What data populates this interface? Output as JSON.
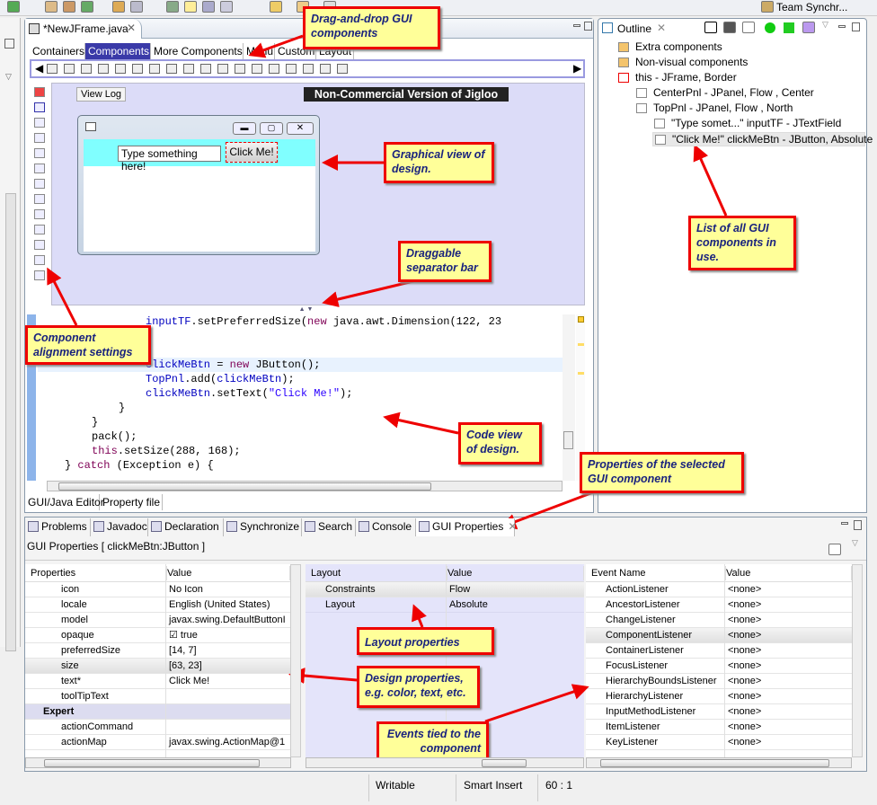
{
  "editor": {
    "tab_title": "*NewJFrame.java",
    "palette_tabs": [
      "Containers",
      "Components",
      "More Components",
      "Menu",
      "Custom",
      "Layout"
    ],
    "active_palette_tab": "Components",
    "view_log": "View Log",
    "banner": "Non-Commercial Version of Jigloo",
    "preview": {
      "textfield": "Type something here!",
      "button": "Click Me!",
      "accent_color": "#80ffff"
    },
    "code_lines": [
      {
        "indent": 6,
        "parts": [
          [
            "fd",
            "inputTF"
          ],
          [
            "",
            "."
          ],
          [
            "",
            "setPreferredSize("
          ],
          [
            "kw",
            "new"
          ],
          [
            "",
            " java.awt.Dimension(122, 23"
          ]
        ]
      },
      {
        "indent": 5,
        "parts": [
          [
            "",
            "}"
          ]
        ]
      },
      {
        "indent": 5,
        "parts": [
          [
            "",
            "{"
          ]
        ]
      },
      {
        "indent": 6,
        "highlight": true,
        "parts": [
          [
            "fd",
            "clickMeBtn"
          ],
          [
            "",
            " = "
          ],
          [
            "kw",
            "new"
          ],
          [
            "",
            " JButton();"
          ]
        ]
      },
      {
        "indent": 6,
        "parts": [
          [
            "fd",
            "TopPnl"
          ],
          [
            "",
            ".add("
          ],
          [
            "fd",
            "clickMeBtn"
          ],
          [
            "",
            ");"
          ]
        ]
      },
      {
        "indent": 6,
        "parts": [
          [
            "fd",
            "clickMeBtn"
          ],
          [
            "",
            ".setText("
          ],
          [
            "st",
            "\"Click Me!\""
          ],
          [
            "",
            ");"
          ]
        ]
      },
      {
        "indent": 5,
        "parts": [
          [
            "",
            "}"
          ]
        ]
      },
      {
        "indent": 4,
        "parts": [
          [
            "",
            "}"
          ]
        ]
      },
      {
        "indent": 4,
        "parts": [
          [
            "",
            "pack();"
          ]
        ]
      },
      {
        "indent": 4,
        "parts": [
          [
            "kw",
            "this"
          ],
          [
            "",
            ".setSize(288, 168);"
          ]
        ]
      },
      {
        "indent": 3,
        "parts": [
          [
            "",
            "} "
          ],
          [
            "kw",
            "catch"
          ],
          [
            "",
            " (Exception e) {"
          ]
        ]
      }
    ],
    "bottom_tabs": [
      "GUI/Java Editor",
      "Property file"
    ]
  },
  "outline": {
    "title": "Outline",
    "items": [
      {
        "label": "Extra components",
        "icon": "folder-icon",
        "level": 0
      },
      {
        "label": "Non-visual components",
        "icon": "folder-icon",
        "level": 0
      },
      {
        "label": "this - JFrame, Border",
        "icon": "frame-icon",
        "level": 0
      },
      {
        "label": "CenterPnl - JPanel, Flow , Center",
        "icon": "panel-icon",
        "level": 1
      },
      {
        "label": "TopPnl - JPanel, Flow , North",
        "icon": "panel-icon",
        "level": 1
      },
      {
        "label": "\"Type somet...\" inputTF - JTextField",
        "icon": "textfield-icon",
        "level": 2
      },
      {
        "label": "\"Click Me!\" clickMeBtn - JButton, Absolute",
        "icon": "button-icon",
        "level": 2,
        "selected": true
      }
    ]
  },
  "bottom": {
    "tabs": [
      "Problems",
      "Javadoc",
      "Declaration",
      "Synchronize",
      "Search",
      "Console",
      "GUI Properties"
    ],
    "active_tab": "GUI Properties",
    "subtitle": "GUI Properties [ clickMeBtn:JButton ]",
    "properties": {
      "headers": [
        "Properties",
        "Value"
      ],
      "rows": [
        {
          "name": "icon",
          "value": "No Icon"
        },
        {
          "name": "locale",
          "value": "English (United States)"
        },
        {
          "name": "model",
          "value": "javax.swing.DefaultButtonI"
        },
        {
          "name": "opaque",
          "value": "☑ true"
        },
        {
          "name": "preferredSize",
          "value": "[14, 7]"
        },
        {
          "name": "size",
          "value": "[63, 23]",
          "selected": true
        },
        {
          "name": "text*",
          "value": "Click Me!"
        },
        {
          "name": "toolTipText",
          "value": ""
        },
        {
          "name": "Expert",
          "value": "",
          "group": true
        },
        {
          "name": "actionCommand",
          "value": ""
        },
        {
          "name": "actionMap",
          "value": "javax.swing.ActionMap@1"
        }
      ]
    },
    "layout": {
      "headers": [
        "Layout",
        "Value"
      ],
      "rows": [
        {
          "name": "Constraints",
          "value": "Flow",
          "selected": true
        },
        {
          "name": "Layout",
          "value": "Absolute"
        }
      ]
    },
    "events": {
      "headers": [
        "Event Name",
        "Value"
      ],
      "rows": [
        {
          "name": "ActionListener",
          "value": "<none>"
        },
        {
          "name": "AncestorListener",
          "value": "<none>"
        },
        {
          "name": "ChangeListener",
          "value": "<none>"
        },
        {
          "name": "ComponentListener",
          "value": "<none>",
          "selected": true
        },
        {
          "name": "ContainerListener",
          "value": "<none>"
        },
        {
          "name": "FocusListener",
          "value": "<none>"
        },
        {
          "name": "HierarchyBoundsListener",
          "value": "<none>"
        },
        {
          "name": "HierarchyListener",
          "value": "<none>"
        },
        {
          "name": "InputMethodListener",
          "value": "<none>"
        },
        {
          "name": "ItemListener",
          "value": "<none>"
        },
        {
          "name": "KeyListener",
          "value": "<none>"
        }
      ]
    }
  },
  "status": {
    "mode": "Writable",
    "insert": "Smart Insert",
    "position": "60 : 1"
  },
  "top_right": {
    "perspective": "Team Synchr..."
  },
  "callouts": {
    "palette": "Drag-and-drop GUI components",
    "graphical": "Graphical view of design.",
    "separator": "Draggable separator bar",
    "alignment": "Component alignment settings",
    "code": "Code view of design.",
    "selected_props": "Properties of the selected GUI component",
    "outline": "List of all GUI components in use.",
    "layout_props": "Layout properties",
    "design_props": "Design properties, e.g. color, text, etc.",
    "events": "Events tied to the component"
  },
  "colors": {
    "annotation_border": "#ee0000",
    "annotation_fill": "#ffff99",
    "design_bg": "#dcdcf8",
    "palette_active": "#3a3aa8"
  }
}
